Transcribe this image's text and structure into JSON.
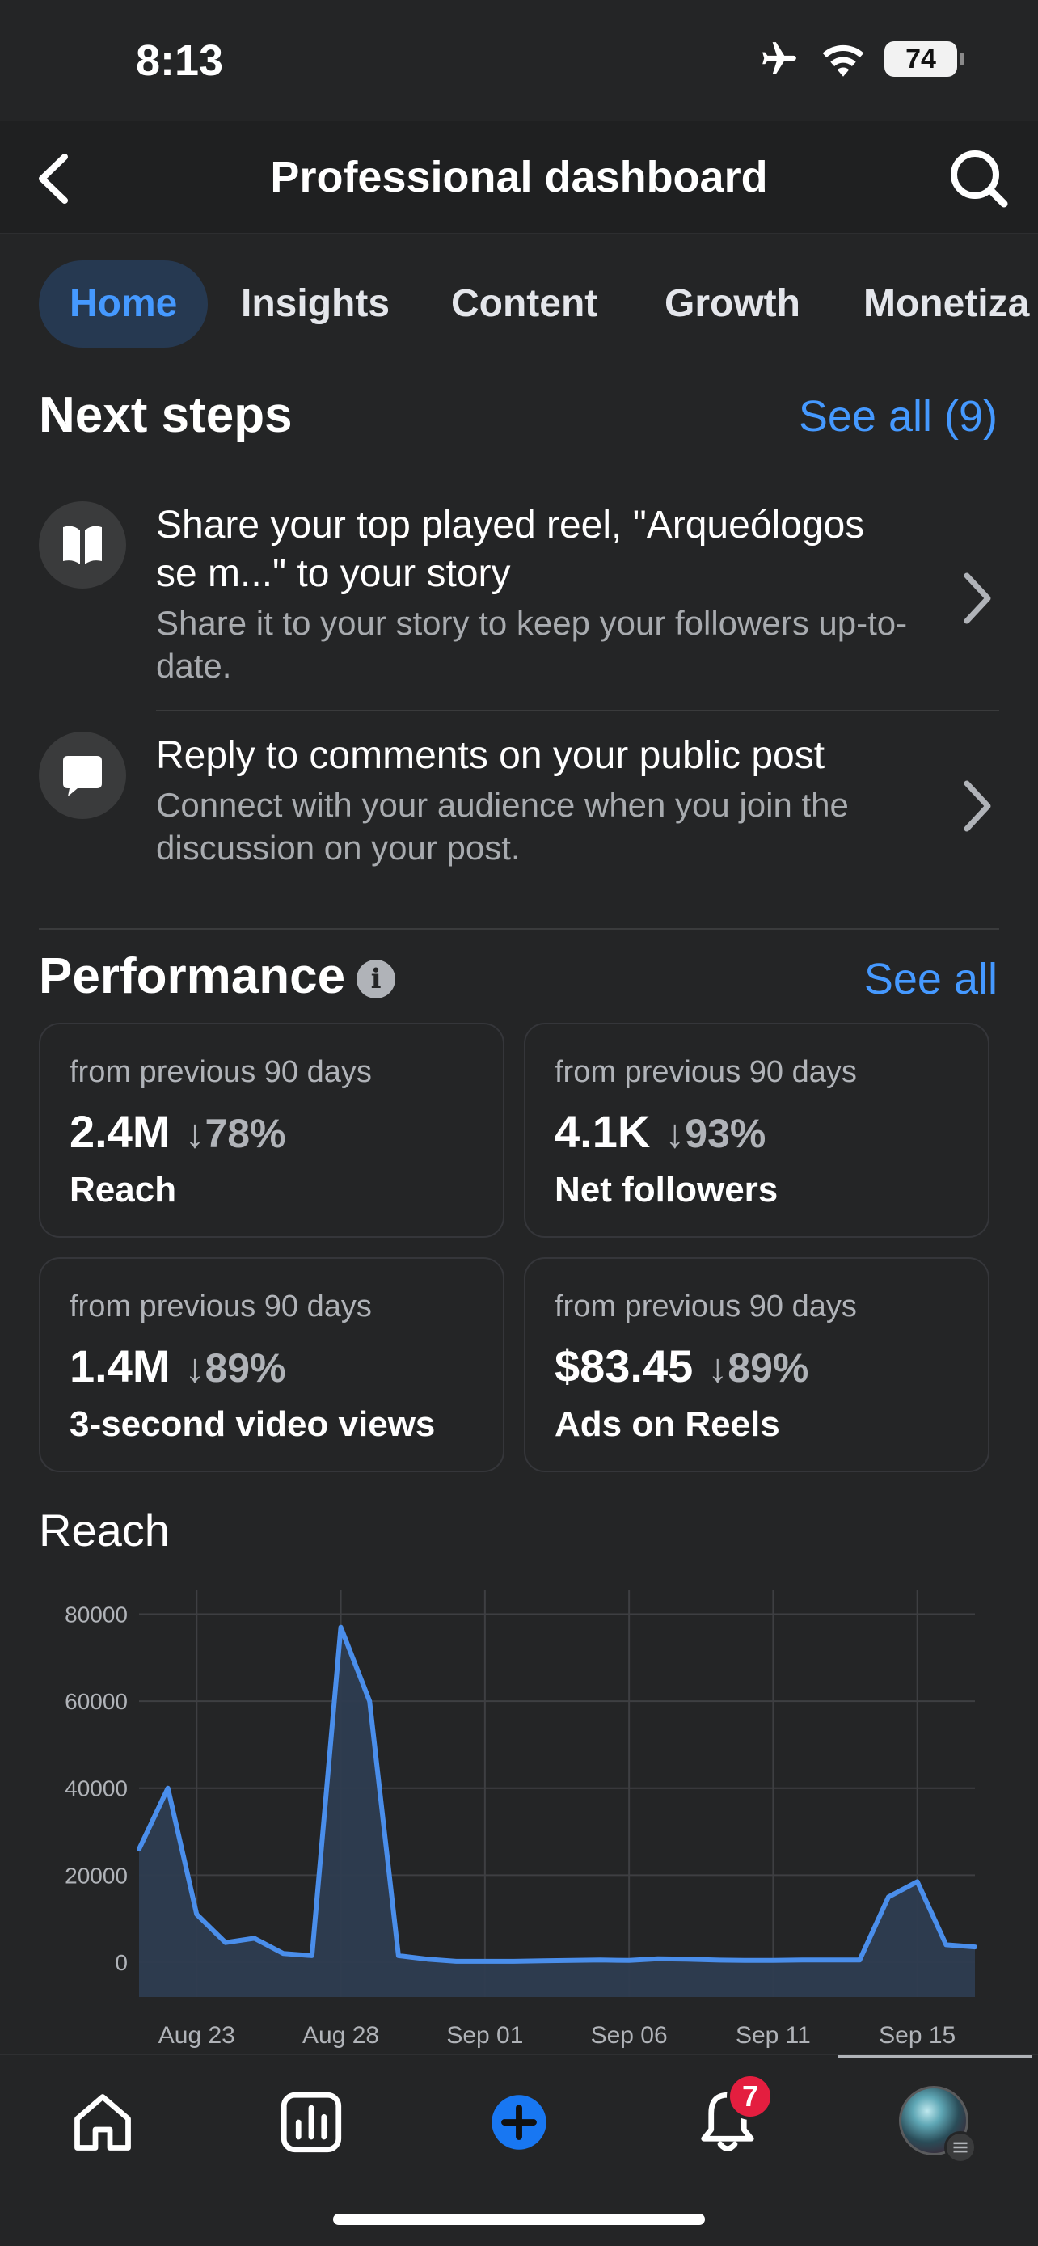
{
  "status_bar": {
    "time": "8:13",
    "battery": "74"
  },
  "header": {
    "title": "Professional dashboard"
  },
  "tabs": [
    {
      "label": "Home",
      "active": true
    },
    {
      "label": "Insights",
      "active": false
    },
    {
      "label": "Content",
      "active": false
    },
    {
      "label": "Growth",
      "active": false
    },
    {
      "label": "Monetiza",
      "active": false
    }
  ],
  "next_steps": {
    "title": "Next steps",
    "see_all": "See all (9)",
    "items": [
      {
        "icon": "book-icon",
        "title": "Share your top played reel, \"Arqueólogos se m...\" to your story",
        "subtitle": "Share it to your story to keep your followers up-to-date."
      },
      {
        "icon": "comment-icon",
        "title": "Reply to comments on your public post",
        "subtitle": "Connect with your audience when you join the discussion on your post."
      }
    ]
  },
  "performance": {
    "title": "Performance",
    "see_all": "See all",
    "cards": [
      {
        "sub": "from previous 90 days",
        "value": "2.4M",
        "delta": "↓78%",
        "label": "Reach"
      },
      {
        "sub": "from previous 90 days",
        "value": "4.1K",
        "delta": "↓93%",
        "label": "Net followers"
      },
      {
        "sub": "from previous 90 days",
        "value": "1.4M",
        "delta": "↓89%",
        "label": "3-second video views"
      },
      {
        "sub": "from previous 90 days",
        "value": "$83.45",
        "delta": "↓89%",
        "label": "Ads on Reels"
      }
    ]
  },
  "chart_data": {
    "type": "area",
    "title": "Reach",
    "x_ticks": [
      "Aug 23",
      "Aug 28",
      "Sep 01",
      "Sep 06",
      "Sep 11",
      "Sep 15"
    ],
    "x_tick_days": [
      2,
      7,
      12,
      17,
      22,
      27
    ],
    "y_ticks": [
      0,
      20000,
      40000,
      60000,
      80000
    ],
    "ylim": [
      -8000,
      84000
    ],
    "grid": true,
    "color": "#4a8eeb",
    "series": [
      {
        "days": [
          0,
          1,
          2,
          3,
          4,
          5,
          6,
          7,
          8,
          9,
          10,
          11,
          12,
          13,
          14,
          15,
          16,
          17,
          18,
          19,
          20,
          21,
          22,
          23,
          24,
          25,
          26,
          27,
          28,
          29
        ],
        "values": [
          26000,
          40000,
          11000,
          4500,
          5500,
          2000,
          1500,
          77000,
          60000,
          1500,
          700,
          200,
          200,
          200,
          300,
          400,
          500,
          400,
          800,
          700,
          500,
          400,
          400,
          500,
          500,
          500,
          15000,
          18500,
          4000,
          3500
        ]
      }
    ]
  },
  "bottom_nav": {
    "notifications_badge": "7"
  }
}
